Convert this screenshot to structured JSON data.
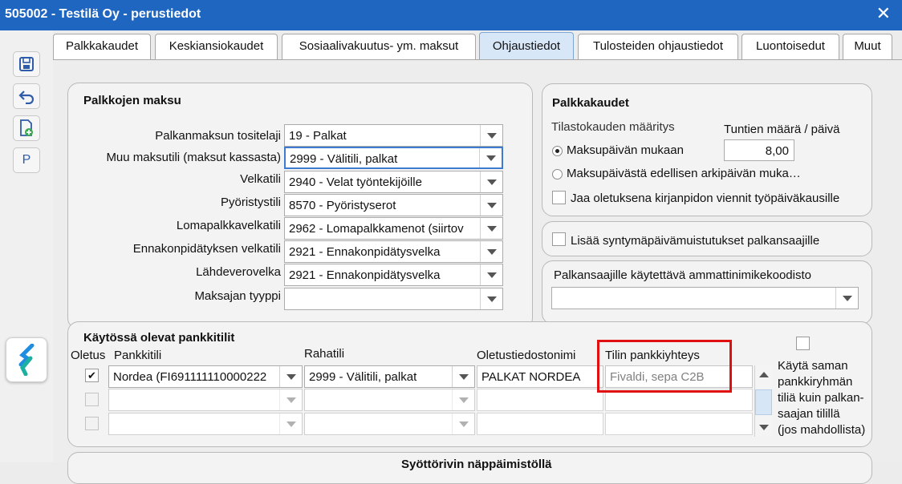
{
  "window": {
    "title": "505002 - Testilä Oy - perustiedot",
    "close_label": "✕"
  },
  "sidebar": {
    "p_label": "P"
  },
  "tabs": [
    {
      "label": "Palkkakaudet"
    },
    {
      "label": "Keskiansiokaudet"
    },
    {
      "label": "Sosiaalivakuutus- ym. maksut"
    },
    {
      "label": "Ohjaustiedot",
      "active": true
    },
    {
      "label": "Tulosteiden ohjaustiedot"
    },
    {
      "label": "Luontoisedut"
    },
    {
      "label": "Muut"
    }
  ],
  "palkkojen_maksu": {
    "title": "Palkkojen maksu",
    "fields": [
      {
        "label": "Palkanmaksun tositelaji",
        "value": "19 - Palkat"
      },
      {
        "label": "Muu maksutili (maksut kassasta)",
        "value": "2999 - Välitili, palkat"
      },
      {
        "label": "Velkatili",
        "value": "2940 - Velat työntekijöille"
      },
      {
        "label": "Pyöristystili",
        "value": "8570 - Pyöristyserot"
      },
      {
        "label": "Lomapalkkavelkatili",
        "value": "2962 - Lomapalkkamenot (siirtov"
      },
      {
        "label": "Ennakonpidätyksen velkatili",
        "value": "2921 - Ennakonpidätysvelka"
      },
      {
        "label": "Lähdeverovelka",
        "value": "2921 - Ennakonpidätysvelka"
      },
      {
        "label": "Maksajan tyyppi",
        "value": ""
      }
    ]
  },
  "palkkakaudet": {
    "title": "Palkkakaudet",
    "tilastokausi_label": "Tilastokauden määritys",
    "tunnit_label": "Tuntien määrä / päivä",
    "tunnit_value": "8,00",
    "radio1": "Maksupäivän mukaan",
    "radio2": "Maksupäivästä edellisen arkipäivän muka…",
    "jaa_label": "Jaa oletuksena kirjanpidon viennit työpäiväkausille"
  },
  "syntymapaiva": {
    "label": "Lisää syntymäpäivämuistutukset palkansaajille"
  },
  "ammattinimike": {
    "title": "Palkansaajille käytettävä ammattinimikekoodisto",
    "value": ""
  },
  "pankkitilit": {
    "title": "Käytössä olevat pankkitilit",
    "headers": {
      "oletus": "Oletus",
      "pankkitili": "Pankkitili",
      "rahatili": "Rahatili",
      "oletustiedostonimi": "Oletustiedostonimi",
      "tilin_pankkiyhteys": "Tilin pankkiyhteys"
    },
    "rows": [
      {
        "oletus": true,
        "pankkitili": "Nordea (FI691111110000222",
        "rahatili": "2999 - Välitili, palkat",
        "oletustiedostonimi": "PALKAT NORDEA",
        "pankkiyhteys": "Fivaldi, sepa C2B"
      },
      {
        "oletus": false,
        "pankkitili": "",
        "rahatili": "",
        "oletustiedostonimi": "",
        "pankkiyhteys": ""
      },
      {
        "oletus": false,
        "pankkitili": "",
        "rahatili": "",
        "oletustiedostonimi": "",
        "pankkiyhteys": ""
      }
    ],
    "kayta_saman_lines": [
      "Käytä saman",
      "pankkiryhmän",
      "tiliä kuin palkan-",
      "saajan tilillä",
      "(jos mahdollista)"
    ]
  },
  "bottom_group": {
    "title": "Syöttörivin näppäimistöllä"
  },
  "colors": {
    "titlebar": "#1f66c1",
    "active_tab": "#d8e7f7",
    "highlight": "#e01010"
  }
}
